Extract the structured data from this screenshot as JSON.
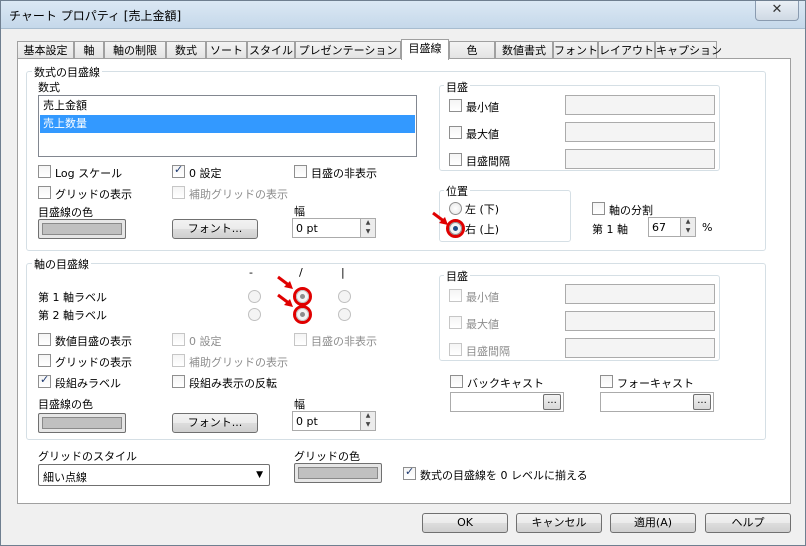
{
  "window": {
    "title": "チャート プロパティ [売上金額]",
    "close_label": "✕"
  },
  "tabs": [
    "基本設定",
    "軸",
    "軸の制限",
    "数式",
    "ソート",
    "スタイル",
    "プレゼンテーション",
    "目盛線",
    "色",
    "数値書式",
    "フォント",
    "レイアウト",
    "キャプション"
  ],
  "expression_grid": {
    "group_title": "数式の目盛線",
    "list_label": "数式",
    "expressions": [
      "売上金額",
      "売上数量"
    ],
    "log_scale": "Log スケール",
    "zero_setting": "0 設定",
    "hide_grid": "目盛の非表示",
    "show_grid": "グリッドの表示",
    "minor_grid": "補助グリッドの表示",
    "line_color_label": "目盛線の色",
    "font_button": "フォント...",
    "width_label": "幅",
    "width_value": "0 pt",
    "scale": {
      "title": "目盛",
      "min": "最小値",
      "max": "最大値",
      "interval": "目盛間隔"
    },
    "position": {
      "title": "位置",
      "left": "左 (下)",
      "right": "右 (上)"
    },
    "axis_split": "軸の分割",
    "primary_axis": "第 1 軸",
    "split_value": "67",
    "percent": "%"
  },
  "dimension_grid": {
    "group_title": "軸の目盛線",
    "col_dash": "-",
    "col_slash": "/",
    "col_bar": "|",
    "label1": "第 1 軸ラベル",
    "label2": "第 2 軸ラベル",
    "show_numeric": "数値目盛の表示",
    "zero_setting": "0 設定",
    "hide_grid": "目盛の非表示",
    "show_grid": "グリッドの表示",
    "minor_grid": "補助グリッドの表示",
    "stacked_label": "段組みラベル",
    "reverse_stack": "段組み表示の反転",
    "line_color_label": "目盛線の色",
    "font_button": "フォント...",
    "width_label": "幅",
    "width_value": "0 pt",
    "scale": {
      "title": "目盛",
      "min": "最小値",
      "max": "最大値",
      "interval": "目盛間隔"
    },
    "backcast": "バックキャスト",
    "forecast": "フォーキャスト",
    "dots": "..."
  },
  "bottom": {
    "grid_style_label": "グリッドのスタイル",
    "grid_style_value": "細い点線",
    "grid_color_label": "グリッドの色",
    "align_zero": "数式の目盛線を 0 レベルに揃える"
  },
  "buttons": {
    "ok": "OK",
    "cancel": "キャンセル",
    "apply": "適用(A)",
    "help": "ヘルプ"
  }
}
